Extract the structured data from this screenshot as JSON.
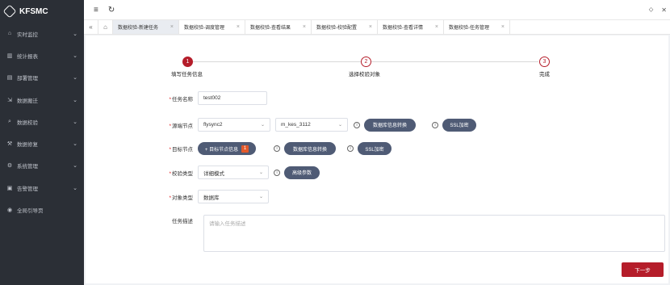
{
  "app": {
    "name": "KFSMC"
  },
  "sidebar": {
    "items": [
      {
        "icon": "dashboard-icon",
        "glyph": "⌂",
        "label": "实时监控"
      },
      {
        "icon": "chart-icon",
        "glyph": "▥",
        "label": "统计报表"
      },
      {
        "icon": "deploy-icon",
        "glyph": "▤",
        "label": "部署管理"
      },
      {
        "icon": "migrate-icon",
        "glyph": "⇲",
        "label": "数据搬迁"
      },
      {
        "icon": "check-icon",
        "glyph": "⌕",
        "label": "数据校验"
      },
      {
        "icon": "repair-icon",
        "glyph": "⚒",
        "label": "数据修复"
      },
      {
        "icon": "settings-icon",
        "glyph": "⚙",
        "label": "系统管理"
      },
      {
        "icon": "alarm-icon",
        "glyph": "▣",
        "label": "告警管理"
      },
      {
        "icon": "guide-icon",
        "glyph": "◉",
        "label": "全局引导页"
      }
    ]
  },
  "topbar": {
    "menu_glyph": "≡",
    "refresh_glyph": "↻",
    "tag_glyph": "⬦",
    "close_glyph": "✕"
  },
  "tabs": {
    "collapse_glyph": "«",
    "home_glyph": "⌂",
    "items": [
      {
        "label": "数据校验-新建任务",
        "active": true
      },
      {
        "label": "数据校验-调度管理",
        "active": false
      },
      {
        "label": "数据校验-查看结果",
        "active": false
      },
      {
        "label": "数据校验-校验配置",
        "active": false
      },
      {
        "label": "数据校验-查看详情",
        "active": false
      },
      {
        "label": "数据校验-任务管理",
        "active": false
      }
    ],
    "close_glyph": "×"
  },
  "steps": [
    {
      "num": "1",
      "label": "填写任务信息"
    },
    {
      "num": "2",
      "label": "选择校验对象"
    },
    {
      "num": "3",
      "label": "完成"
    }
  ],
  "form": {
    "req_mark": "*",
    "task_name": {
      "label": "任务名称",
      "value": "test002"
    },
    "source": {
      "label": "源端节点",
      "node_value": "flysync2",
      "db_value": "m_kes_3112",
      "convert_button": "数据库信息转换",
      "ssl_button": "SSL加密"
    },
    "target": {
      "label": "目标节点",
      "add_button": "+ 目标节点信息",
      "count": "1",
      "convert_button": "数据库信息转换",
      "ssl_button": "SSL加密"
    },
    "check_type": {
      "label": "校验类型",
      "value": "详细模式",
      "adv_button": "高级参数"
    },
    "object_type": {
      "label": "对象类型",
      "value": "数据库"
    },
    "desc": {
      "label": "任务描述",
      "placeholder": "请输入任务描述"
    },
    "info_glyph": "i",
    "arrow_glyph": "⌄"
  },
  "actions": {
    "next": "下一步"
  },
  "colors": {
    "brand": "#b51d2a",
    "sidebar_bg": "#2b2f36",
    "button_dark": "#4f5b75"
  }
}
